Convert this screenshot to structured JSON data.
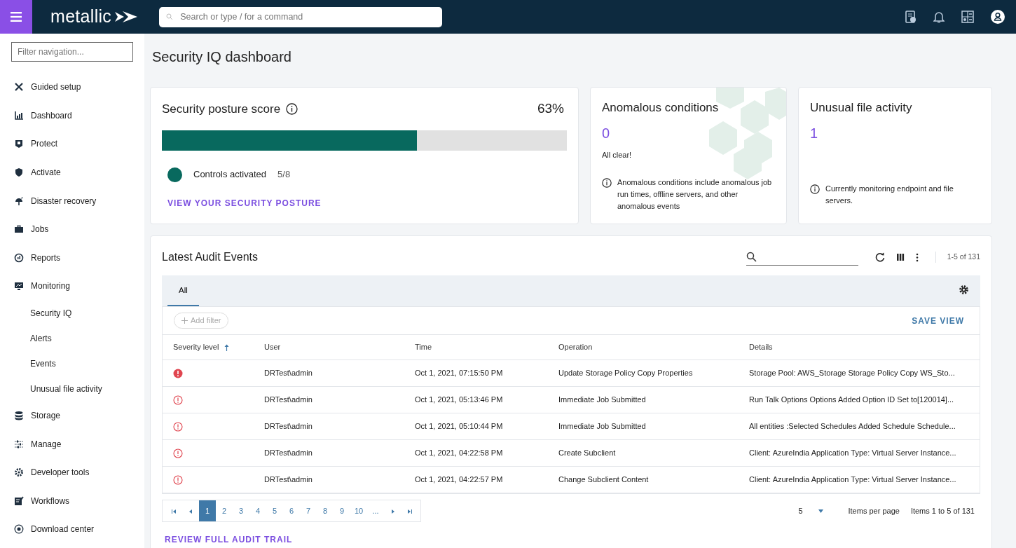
{
  "topbar": {
    "logo": "metallic",
    "search": {
      "placeholder": "Search or type / for a command"
    }
  },
  "sidebar": {
    "filter": {
      "placeholder": "Filter navigation..."
    },
    "items": [
      {
        "label": "Guided setup"
      },
      {
        "label": "Dashboard"
      },
      {
        "label": "Protect"
      },
      {
        "label": "Activate"
      },
      {
        "label": "Disaster recovery"
      },
      {
        "label": "Jobs"
      },
      {
        "label": "Reports"
      },
      {
        "label": "Monitoring",
        "children": [
          {
            "label": "Security IQ"
          },
          {
            "label": "Alerts"
          },
          {
            "label": "Events"
          },
          {
            "label": "Unusual file activity"
          }
        ]
      },
      {
        "label": "Storage"
      },
      {
        "label": "Manage"
      },
      {
        "label": "Developer tools"
      },
      {
        "label": "Workflows"
      },
      {
        "label": "Download center"
      }
    ]
  },
  "page": {
    "title": "Security IQ dashboard"
  },
  "posture": {
    "title": "Security posture score",
    "score": "63%",
    "level": 0.63,
    "legend": "Controls activated",
    "count": "5/8",
    "link": "VIEW YOUR SECURITY POSTURE"
  },
  "anomalous": {
    "title": "Anomalous conditions",
    "value": "0",
    "status": "All clear!",
    "note": "Anomalous conditions include anomalous job run times, offline servers, and other anomalous events"
  },
  "unusual": {
    "title": "Unusual file activity",
    "value": "1",
    "note": "Currently monitoring endpoint and file servers."
  },
  "audit": {
    "title": "Latest Audit Events",
    "range": "1-5 of 131",
    "tabs": [
      {
        "label": "All",
        "selected": true
      }
    ],
    "add_filter": "Add filter",
    "save_view": "SAVE VIEW",
    "columns": [
      "Severity level",
      "User",
      "Time",
      "Operation",
      "Details"
    ],
    "rows": [
      {
        "kind": "critical",
        "user": "DRTest\\admin",
        "time": "Oct 1, 2021, 07:15:50 PM",
        "operation": "Update Storage Policy Copy Properties",
        "details": "Storage Pool: AWS_Storage Storage Policy Copy WS_Sto..."
      },
      {
        "kind": "warning",
        "user": "DRTest\\admin",
        "time": "Oct 1, 2021, 05:13:46 PM",
        "operation": "Immediate Job Submitted",
        "details": "Run Talk Options Options Added Option ID Set to[120014]..."
      },
      {
        "kind": "warning",
        "user": "DRTest\\admin",
        "time": "Oct 1, 2021, 05:10:44 PM",
        "operation": "Immediate Job Submitted",
        "details": "All entities :Selected Schedules Added Schedule Schedule..."
      },
      {
        "kind": "warning",
        "user": "DRTest\\admin",
        "time": "Oct 1, 2021, 04:22:58 PM",
        "operation": "Create Subclient",
        "details": "Client: AzureIndia Application Type: Virtual Server Instance..."
      },
      {
        "kind": "warning",
        "user": "DRTest\\admin",
        "time": "Oct 1, 2021, 04:22:57 PM",
        "operation": "Change Subclient Content",
        "details": "Client: AzureIndia Application Type: Virtual Server Instance..."
      }
    ],
    "pages": [
      {
        "label": "1",
        "selected": true
      },
      {
        "label": "2",
        "selected": false
      },
      {
        "label": "3",
        "selected": false
      },
      {
        "label": "4",
        "selected": false
      },
      {
        "label": "5",
        "selected": false
      },
      {
        "label": "6",
        "selected": false
      },
      {
        "label": "7",
        "selected": false
      },
      {
        "label": "8",
        "selected": false
      },
      {
        "label": "9",
        "selected": false
      },
      {
        "label": "10",
        "selected": false
      },
      {
        "label": "...",
        "selected": false
      }
    ],
    "page_size": "5",
    "page_size_label": "Items per page",
    "items_info": "Items 1 to 5 of 131",
    "review_link": "REVIEW FULL AUDIT TRAIL"
  }
}
